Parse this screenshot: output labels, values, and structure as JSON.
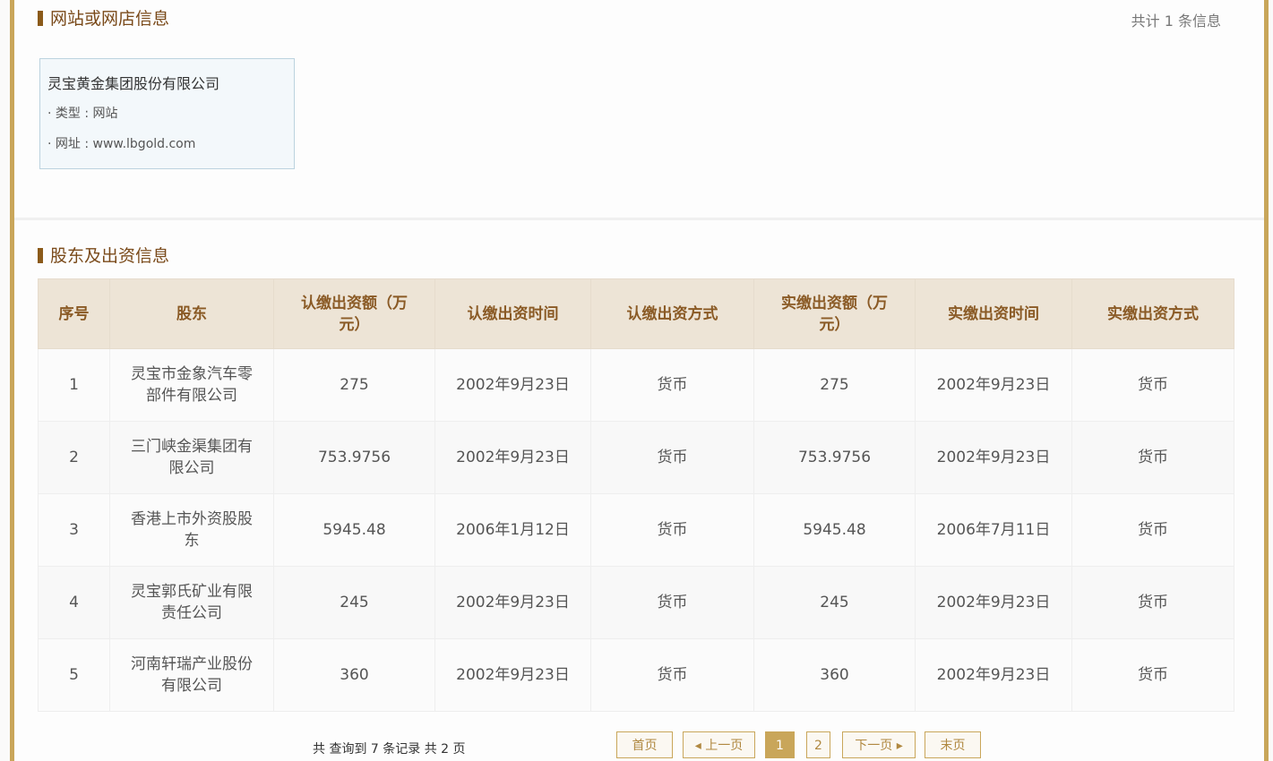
{
  "website_section": {
    "title": "网站或网店信息",
    "total": "共计 1 条信息",
    "card": {
      "name": "灵宝黄金集团股份有限公司",
      "type_line": "· 类型 : 网站",
      "url_line": "· 网址 : www.lbgold.com"
    }
  },
  "shareholder_section": {
    "title": "股东及出资信息",
    "headers": [
      "序号",
      "股东",
      "认缴出资额（万元）",
      "认缴出资时间",
      "认缴出资方式",
      "实缴出资额（万元）",
      "实缴出资时间",
      "实缴出资方式"
    ],
    "rows": [
      [
        "1",
        "灵宝市金象汽车零部件有限公司",
        "275",
        "2002年9月23日",
        "货币",
        "275",
        "2002年9月23日",
        "货币"
      ],
      [
        "2",
        "三门峡金渠集团有限公司",
        "753.9756",
        "2002年9月23日",
        "货币",
        "753.9756",
        "2002年9月23日",
        "货币"
      ],
      [
        "3",
        "香港上市外资股股东",
        "5945.48",
        "2006年1月12日",
        "货币",
        "5945.48",
        "2006年7月11日",
        "货币"
      ],
      [
        "4",
        "灵宝郭氏矿业有限责任公司",
        "245",
        "2002年9月23日",
        "货币",
        "245",
        "2002年9月23日",
        "货币"
      ],
      [
        "5",
        "河南轩瑞产业股份有限公司",
        "360",
        "2002年9月23日",
        "货币",
        "360",
        "2002年9月23日",
        "货币"
      ]
    ]
  },
  "pagination": {
    "summary": "共 查询到 7 条记录 共 2 页",
    "first": "首页",
    "prev": "◂ 上一页",
    "pages": [
      "1",
      "2"
    ],
    "current_page": "1",
    "next": "下一页 ▸",
    "last": "末页"
  }
}
